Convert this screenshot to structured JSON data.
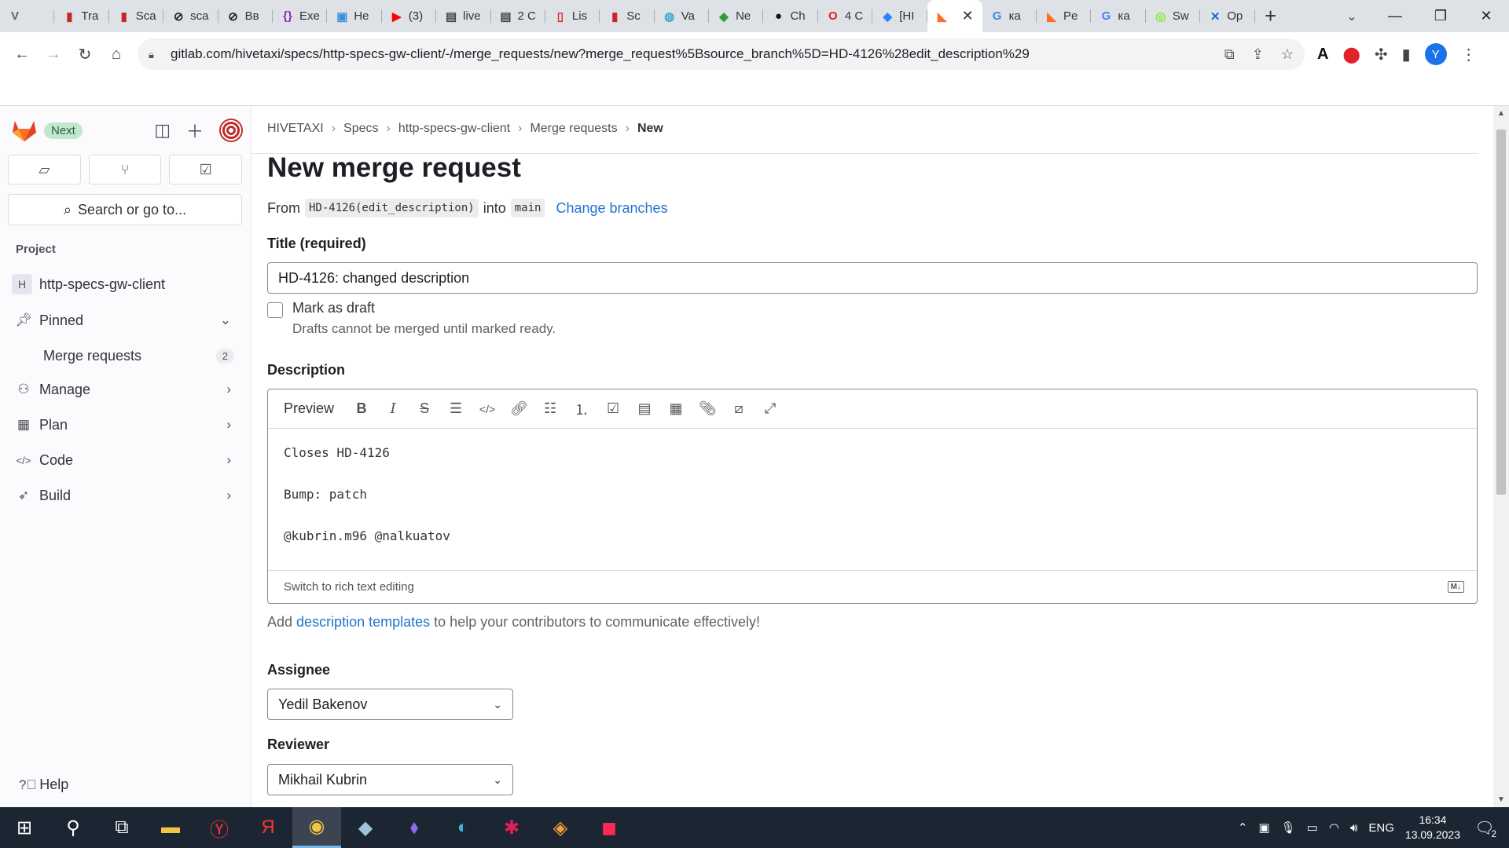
{
  "browser": {
    "tabs": [
      {
        "label": "",
        "icon": "dropdown-v-icon",
        "color": "#5f6368"
      },
      {
        "label": "Tra",
        "icon": "scroll-red-icon",
        "color": "#c62828"
      },
      {
        "label": "Sca",
        "icon": "scroll-red-icon",
        "color": "#c62828"
      },
      {
        "label": "sca",
        "icon": "circle-slash-icon",
        "color": "#222222"
      },
      {
        "label": "Вв",
        "icon": "circle-slash-icon",
        "color": "#222222"
      },
      {
        "label": "Exe",
        "icon": "bracket-icon",
        "color": "#7b2fbf"
      },
      {
        "label": "He",
        "icon": "app-blue-icon",
        "color": "#3a8fd8"
      },
      {
        "label": "(3)",
        "icon": "youtube-icon",
        "color": "#ff0000"
      },
      {
        "label": "live",
        "icon": "news-icon",
        "color": "#444444"
      },
      {
        "label": "2 С",
        "icon": "news-icon",
        "color": "#444444"
      },
      {
        "label": "Lis",
        "icon": "pdf-icon",
        "color": "#d93025"
      },
      {
        "label": "Sc",
        "icon": "scroll-red-icon",
        "color": "#c62828"
      },
      {
        "label": "Va",
        "icon": "globe-icon",
        "color": "#3fa7c9"
      },
      {
        "label": "Ne",
        "icon": "flag-icon",
        "color": "#2e9c3e"
      },
      {
        "label": "Ch",
        "icon": "github-icon",
        "color": "#111111"
      },
      {
        "label": "4 С",
        "icon": "opera-icon",
        "color": "#e0222b"
      },
      {
        "label": "[HI",
        "icon": "jira-icon",
        "color": "#2684ff"
      },
      {
        "label": "",
        "icon": "gitlab-icon",
        "color": "#fc6d26",
        "active": true
      },
      {
        "label": "ка",
        "icon": "google-icon",
        "color": "#4285f4"
      },
      {
        "label": "Pe",
        "icon": "gitlab-icon",
        "color": "#fc6d26"
      },
      {
        "label": "ка",
        "icon": "google-icon",
        "color": "#4285f4"
      },
      {
        "label": "Sw",
        "icon": "swagger-icon",
        "color": "#85ea2d"
      },
      {
        "label": "Op",
        "icon": "confluence-icon",
        "color": "#1868db"
      }
    ],
    "url_host": "gitlab.com",
    "url_path": "/hivetaxi/specs/http-specs-gw-client/-/merge_requests/new?merge_request%5Bsource_branch%5D=HD-4126%28edit_description%29",
    "profile_initial": "Y"
  },
  "sidebar": {
    "badge": "Next",
    "search_label": "Search or go to...",
    "section_label": "Project",
    "project": {
      "initial": "H",
      "name": "http-specs-gw-client"
    },
    "pinned_label": "Pinned",
    "merge_requests_label": "Merge requests",
    "merge_requests_count": "2",
    "nav": [
      {
        "label": "Manage",
        "icon": "users-icon"
      },
      {
        "label": "Plan",
        "icon": "calendar-icon"
      },
      {
        "label": "Code",
        "icon": "code-icon"
      },
      {
        "label": "Build",
        "icon": "rocket-icon"
      }
    ],
    "help_label": "Help"
  },
  "main": {
    "breadcrumb": [
      "HIVETAXI",
      "Specs",
      "http-specs-gw-client",
      "Merge requests",
      "New"
    ],
    "title": "New merge request",
    "from_label": "From",
    "source_branch": "HD-4126(edit_description)",
    "into_label": "into",
    "target_branch": "main",
    "change_branches": "Change branches",
    "title_label": "Title (required)",
    "title_value": "HD-4126: changed description",
    "draft_label": "Mark as draft",
    "draft_help": "Drafts cannot be merged until marked ready.",
    "description_label": "Description",
    "preview_label": "Preview",
    "description_lines": [
      "Closes HD-4126",
      "Bump: patch",
      "@kubrin.m96 @nalkuatov"
    ],
    "switch_rich_text": "Switch to rich text editing",
    "templates_prefix": "Add",
    "templates_link": "description templates",
    "templates_suffix": "to help your contributors to communicate effectively!",
    "assignee_label": "Assignee",
    "assignee_value": "Yedil Bakenov",
    "reviewer_label": "Reviewer",
    "reviewer_value": "Mikhail Kubrin"
  },
  "taskbar": {
    "language": "ENG",
    "time": "16:34",
    "date": "13.09.2023",
    "notifications": "2"
  }
}
